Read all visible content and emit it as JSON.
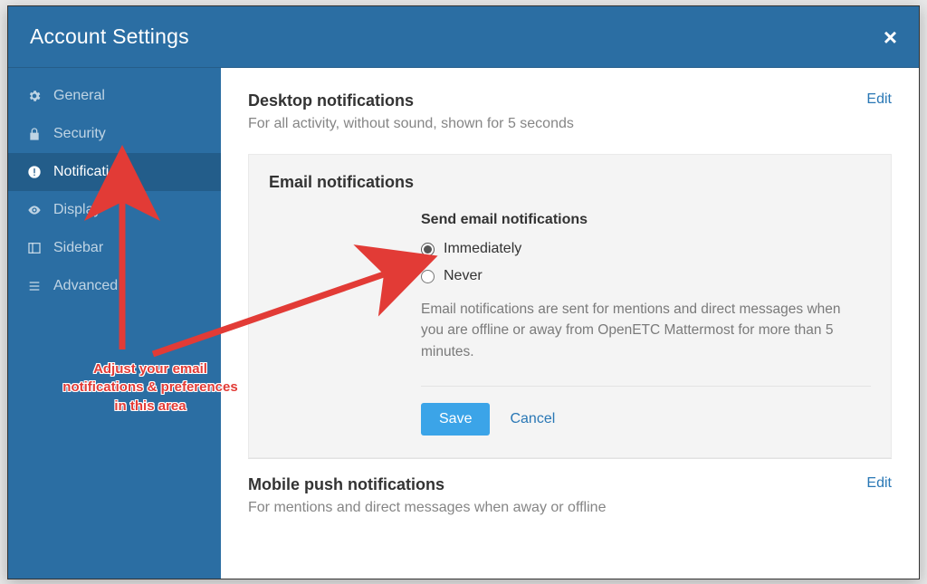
{
  "header": {
    "title": "Account Settings"
  },
  "sidebar": {
    "items": [
      {
        "id": "general",
        "label": "General",
        "icon": "gear"
      },
      {
        "id": "security",
        "label": "Security",
        "icon": "lock"
      },
      {
        "id": "notifications",
        "label": "Notifications",
        "icon": "alert"
      },
      {
        "id": "display",
        "label": "Display",
        "icon": "eye"
      },
      {
        "id": "sidebar",
        "label": "Sidebar",
        "icon": "columns"
      },
      {
        "id": "advanced",
        "label": "Advanced",
        "icon": "list"
      }
    ],
    "active": "notifications"
  },
  "sections": {
    "desktop": {
      "title": "Desktop notifications",
      "desc": "For all activity, without sound, shown for 5 seconds",
      "edit": "Edit"
    },
    "email": {
      "title": "Email notifications",
      "field_label": "Send email notifications",
      "options": [
        {
          "id": "immediately",
          "label": "Immediately",
          "selected": true
        },
        {
          "id": "never",
          "label": "Never",
          "selected": false
        }
      ],
      "help": "Email notifications are sent for mentions and direct messages when you are offline or away from OpenETC Mattermost for more than 5 minutes.",
      "save": "Save",
      "cancel": "Cancel"
    },
    "mobile": {
      "title": "Mobile push notifications",
      "desc": "For mentions and direct messages when away or offline",
      "edit": "Edit"
    }
  },
  "annotation": {
    "text": "Adjust your email notifications & preferences in this area"
  },
  "colors": {
    "brand": "#2b6ea3",
    "link": "#2977b5",
    "save": "#3ba4e8",
    "annotation": "#e23b36"
  }
}
